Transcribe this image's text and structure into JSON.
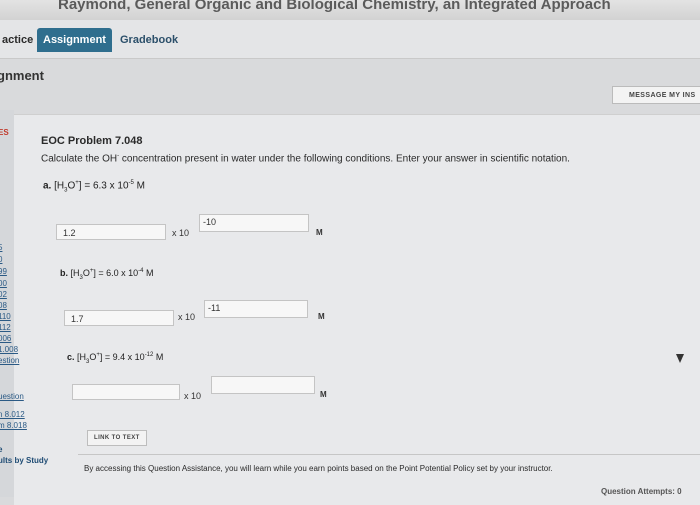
{
  "app_title": "Raymond, General Organic and Biological Chemistry, an Integrated Approach",
  "tabs": [
    {
      "label": "actice"
    },
    {
      "label": "Assignment"
    },
    {
      "label": "Gradebook"
    }
  ],
  "section_title": "gnment",
  "message_button": "MESSAGE MY INS",
  "sidebar": {
    "items": [
      {
        "text": "ES"
      },
      {
        "text": "5"
      },
      {
        "text": "0"
      },
      {
        "text": "99"
      },
      {
        "text": "00"
      },
      {
        "text": "02"
      },
      {
        "text": "08"
      },
      {
        "text": "110"
      },
      {
        "text": "112"
      },
      {
        "text": "006"
      },
      {
        "text": "1.008"
      },
      {
        "text": "estion"
      },
      {
        "text": "uestion"
      },
      {
        "text": "n 8.012"
      },
      {
        "text": "m 8.018"
      },
      {
        "text": "e"
      },
      {
        "text": "ults by Study"
      }
    ]
  },
  "problem": {
    "title": "EOC Problem 7.048",
    "instructions_pre": "Calculate the OH",
    "instructions_sup": "-",
    "instructions_post": " concentration present in water under the following conditions. Enter your answer in scientific notation."
  },
  "parts": [
    {
      "letter": "a.",
      "h_pre": "[H",
      "h_sub": "3",
      "h_mid": "O",
      "h_sup": "+",
      "h_post": "] = 6.3 x 10",
      "exp": "-5",
      "unit": " M",
      "answer": "1.2",
      "exponent": "-10",
      "times": "x 10",
      "m": "M"
    },
    {
      "letter": "b.",
      "h_pre": "[H",
      "h_sub": "3",
      "h_mid": "O",
      "h_sup": "+",
      "h_post": "] = 6.0 x 10",
      "exp": "-4",
      "unit": " M",
      "answer": "1.7",
      "exponent": "-11",
      "times": "x 10",
      "m": "M"
    },
    {
      "letter": "c.",
      "h_pre": "[H",
      "h_sub": "3",
      "h_mid": "O",
      "h_sup": "+",
      "h_post": "] = 9.4 x 10",
      "exp": "-12",
      "unit": " M",
      "answer": "",
      "exponent": "",
      "times": "x 10",
      "m": "M"
    }
  ],
  "link_button": "LINK TO TEXT",
  "footer_note": "By accessing this Question Assistance, you will learn while you earn points based on the Point Potential Policy set by your instructor.",
  "attempts_label": "Question Attempts: 0"
}
